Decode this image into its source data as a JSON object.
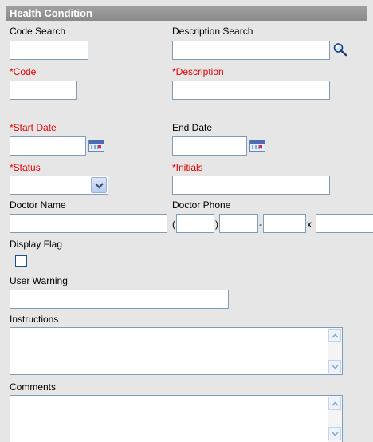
{
  "header": {
    "title": "Health Condition"
  },
  "fields": {
    "code_search": {
      "label": "Code Search",
      "value": ""
    },
    "description_search": {
      "label": "Description Search",
      "value": ""
    },
    "code": {
      "required_mark": "*",
      "label": "Code",
      "value": ""
    },
    "description": {
      "required_mark": "*",
      "label": "Description",
      "value": ""
    },
    "start_date": {
      "required_mark": "*",
      "label": "Start Date",
      "value": ""
    },
    "end_date": {
      "label": "End Date",
      "value": ""
    },
    "status": {
      "required_mark": "*",
      "label": "Status",
      "selected": ""
    },
    "initials": {
      "required_mark": "*",
      "label": "Initials",
      "value": ""
    },
    "doctor_name": {
      "label": "Doctor Name",
      "value": ""
    },
    "doctor_phone": {
      "label": "Doctor Phone",
      "open_paren": "(",
      "close_paren": ")",
      "dash": "-",
      "ext_mark": "x"
    },
    "display_flag": {
      "label": "Display Flag",
      "checked": false
    },
    "user_warning": {
      "label": "User Warning",
      "value": ""
    },
    "instructions": {
      "label": "Instructions",
      "value": ""
    },
    "comments": {
      "label": "Comments",
      "value": ""
    }
  },
  "icons": {
    "search": "magnifier-search-icon",
    "calendar": "calendar-icon",
    "dropdown": "chevron-down-icon",
    "scroll_up": "scroll-up-arrow-icon",
    "scroll_down": "scroll-down-arrow-icon"
  },
  "colors": {
    "required": "#e00000",
    "header_bg": "#8a8a8a",
    "page_bg": "#e6e6e6",
    "input_border": "#7f9db9"
  }
}
